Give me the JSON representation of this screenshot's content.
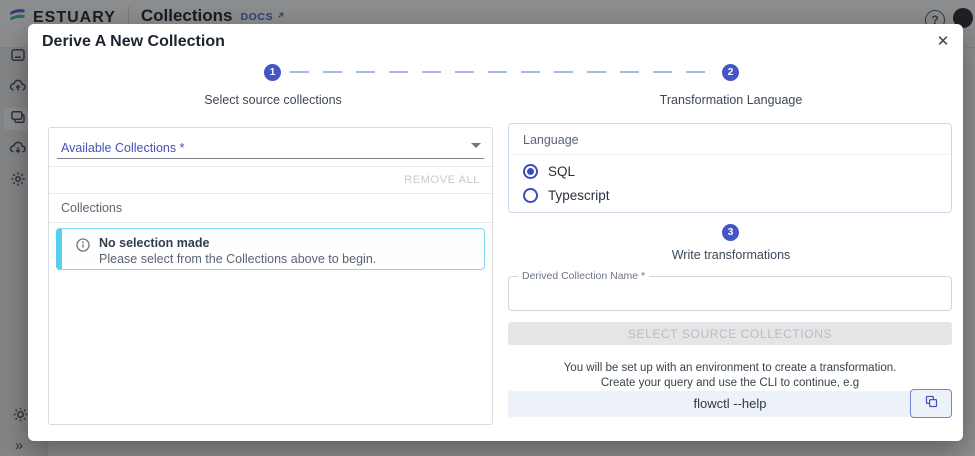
{
  "topbar": {
    "brand": "ESTUARY",
    "page_title": "Collections",
    "docs_label": "DOCS",
    "help_label": "?"
  },
  "sidebar": {
    "items": [
      {
        "name": "home"
      },
      {
        "name": "captures"
      },
      {
        "name": "collections",
        "active": true
      },
      {
        "name": "materializations"
      },
      {
        "name": "admin"
      }
    ]
  },
  "modal": {
    "title": "Derive A New Collection",
    "close_label": "✕",
    "stepper": {
      "step1": {
        "number": "1",
        "label": "Select source collections"
      },
      "step2": {
        "number": "2",
        "label": "Transformation Language"
      }
    },
    "source_panel": {
      "autocomplete_label": "Available Collections *",
      "remove_all": "REMOVE ALL",
      "list_header": "Collections",
      "alert_title": "No selection made",
      "alert_message": "Please select from the Collections above to begin."
    },
    "language_panel": {
      "header": "Language",
      "option_sql": "SQL",
      "option_typescript": "Typescript",
      "selected": "SQL"
    },
    "transform": {
      "step_number": "3",
      "step_label": "Write transformations",
      "name_field_label": "Derived Collection Name *",
      "name_field_value": "",
      "submit_label": "SELECT SOURCE COLLECTIONS",
      "help_line1": "You will be set up with an environment to create a transformation.",
      "help_line2": "Create your query and use the CLI to continue, e.g",
      "cli_command": "flowctl --help"
    }
  },
  "colors": {
    "accent": "#4456c7",
    "alert_cyan": "#55cfee",
    "disabled_bg": "#e4e5e7",
    "disabled_text": "#b8bdc2",
    "code_bg": "#edf1f8"
  }
}
